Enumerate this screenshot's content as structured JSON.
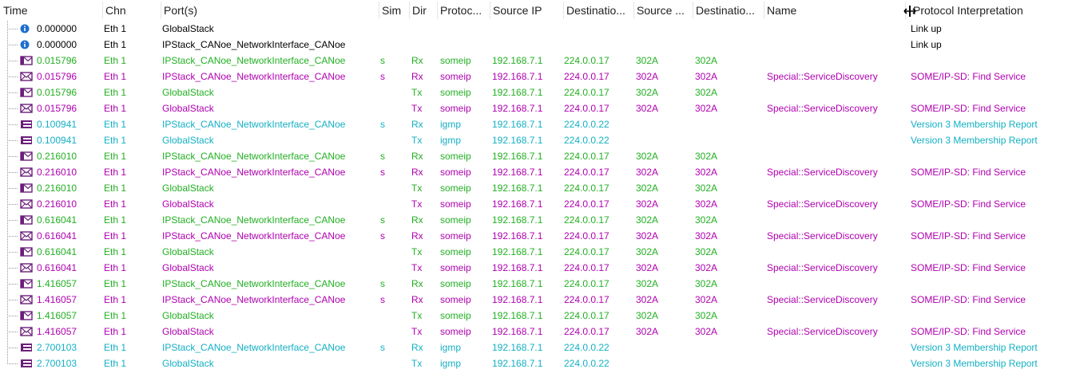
{
  "header": {
    "columns": [
      {
        "key": "time",
        "label": "Time"
      },
      {
        "key": "chn",
        "label": "Chn"
      },
      {
        "key": "ports",
        "label": "Port(s)"
      },
      {
        "key": "sim",
        "label": "Sim"
      },
      {
        "key": "dir",
        "label": "Dir"
      },
      {
        "key": "proto",
        "label": "Protoc..."
      },
      {
        "key": "src_ip",
        "label": "Source IP"
      },
      {
        "key": "dst",
        "label": "Destinatio..."
      },
      {
        "key": "src_port",
        "label": "Source ..."
      },
      {
        "key": "dst_port",
        "label": "Destinatio..."
      },
      {
        "key": "name",
        "label": "Name"
      },
      {
        "key": "interp",
        "label": "Protocol Interpretation"
      }
    ]
  },
  "colors": {
    "black": "#000000",
    "green": "#22b022",
    "magenta": "#b000b0",
    "cyan": "#14b0c4",
    "icon_blue": "#1e6fd0",
    "tree": "#9a9a9a"
  },
  "rows": [
    {
      "icon": "info-icon",
      "color": "black",
      "time": "0.000000",
      "chn": "Eth 1",
      "ports": "GlobalStack",
      "sim": "",
      "dir": "",
      "proto": "",
      "src_ip": "",
      "dst": "",
      "src_port": "",
      "dst_port": "",
      "name": "",
      "interp": "Link up"
    },
    {
      "icon": "info-icon",
      "color": "black",
      "time": "0.000000",
      "chn": "Eth 1",
      "ports": "IPStack_CANoe_NetworkInterface_CANoe",
      "sim": "",
      "dir": "",
      "proto": "",
      "src_ip": "",
      "dst": "",
      "src_port": "",
      "dst_port": "",
      "name": "",
      "interp": "Link up"
    },
    {
      "icon": "frame-icon",
      "color": "green",
      "time": "0.015796",
      "chn": "Eth 1",
      "ports": "IPStack_CANoe_NetworkInterface_CANoe",
      "sim": "s",
      "dir": "Rx",
      "proto": "someip",
      "src_ip": "192.168.7.1",
      "dst": "224.0.0.17",
      "src_port": "302A",
      "dst_port": "302A",
      "name": "",
      "interp": ""
    },
    {
      "icon": "message-icon",
      "color": "magenta",
      "time": "0.015796",
      "chn": "Eth 1",
      "ports": "IPStack_CANoe_NetworkInterface_CANoe",
      "sim": "s",
      "dir": "Rx",
      "proto": "someip",
      "src_ip": "192.168.7.1",
      "dst": "224.0.0.17",
      "src_port": "302A",
      "dst_port": "302A",
      "name": "Special::ServiceDiscovery",
      "interp": "SOME/IP-SD: Find Service"
    },
    {
      "icon": "frame-icon",
      "color": "green",
      "time": "0.015796",
      "chn": "Eth 1",
      "ports": "GlobalStack",
      "sim": "",
      "dir": "Tx",
      "proto": "someip",
      "src_ip": "192.168.7.1",
      "dst": "224.0.0.17",
      "src_port": "302A",
      "dst_port": "302A",
      "name": "",
      "interp": ""
    },
    {
      "icon": "message-icon",
      "color": "magenta",
      "time": "0.015796",
      "chn": "Eth 1",
      "ports": "GlobalStack",
      "sim": "",
      "dir": "Tx",
      "proto": "someip",
      "src_ip": "192.168.7.1",
      "dst": "224.0.0.17",
      "src_port": "302A",
      "dst_port": "302A",
      "name": "Special::ServiceDiscovery",
      "interp": "SOME/IP-SD: Find Service"
    },
    {
      "icon": "packet-icon",
      "color": "cyan",
      "time": "0.100941",
      "chn": "Eth 1",
      "ports": "IPStack_CANoe_NetworkInterface_CANoe",
      "sim": "s",
      "dir": "Rx",
      "proto": "igmp",
      "src_ip": "192.168.7.1",
      "dst": "224.0.0.22",
      "src_port": "",
      "dst_port": "",
      "name": "",
      "interp": "Version 3 Membership Report"
    },
    {
      "icon": "packet-icon",
      "color": "cyan",
      "time": "0.100941",
      "chn": "Eth 1",
      "ports": "GlobalStack",
      "sim": "",
      "dir": "Tx",
      "proto": "igmp",
      "src_ip": "192.168.7.1",
      "dst": "224.0.0.22",
      "src_port": "",
      "dst_port": "",
      "name": "",
      "interp": "Version 3 Membership Report"
    },
    {
      "icon": "frame-icon",
      "color": "green",
      "time": "0.216010",
      "chn": "Eth 1",
      "ports": "IPStack_CANoe_NetworkInterface_CANoe",
      "sim": "s",
      "dir": "Rx",
      "proto": "someip",
      "src_ip": "192.168.7.1",
      "dst": "224.0.0.17",
      "src_port": "302A",
      "dst_port": "302A",
      "name": "",
      "interp": ""
    },
    {
      "icon": "message-icon",
      "color": "magenta",
      "time": "0.216010",
      "chn": "Eth 1",
      "ports": "IPStack_CANoe_NetworkInterface_CANoe",
      "sim": "s",
      "dir": "Rx",
      "proto": "someip",
      "src_ip": "192.168.7.1",
      "dst": "224.0.0.17",
      "src_port": "302A",
      "dst_port": "302A",
      "name": "Special::ServiceDiscovery",
      "interp": "SOME/IP-SD: Find Service"
    },
    {
      "icon": "frame-icon",
      "color": "green",
      "time": "0.216010",
      "chn": "Eth 1",
      "ports": "GlobalStack",
      "sim": "",
      "dir": "Tx",
      "proto": "someip",
      "src_ip": "192.168.7.1",
      "dst": "224.0.0.17",
      "src_port": "302A",
      "dst_port": "302A",
      "name": "",
      "interp": ""
    },
    {
      "icon": "message-icon",
      "color": "magenta",
      "time": "0.216010",
      "chn": "Eth 1",
      "ports": "GlobalStack",
      "sim": "",
      "dir": "Tx",
      "proto": "someip",
      "src_ip": "192.168.7.1",
      "dst": "224.0.0.17",
      "src_port": "302A",
      "dst_port": "302A",
      "name": "Special::ServiceDiscovery",
      "interp": "SOME/IP-SD: Find Service"
    },
    {
      "icon": "frame-icon",
      "color": "green",
      "time": "0.616041",
      "chn": "Eth 1",
      "ports": "IPStack_CANoe_NetworkInterface_CANoe",
      "sim": "s",
      "dir": "Rx",
      "proto": "someip",
      "src_ip": "192.168.7.1",
      "dst": "224.0.0.17",
      "src_port": "302A",
      "dst_port": "302A",
      "name": "",
      "interp": ""
    },
    {
      "icon": "message-icon",
      "color": "magenta",
      "time": "0.616041",
      "chn": "Eth 1",
      "ports": "IPStack_CANoe_NetworkInterface_CANoe",
      "sim": "s",
      "dir": "Rx",
      "proto": "someip",
      "src_ip": "192.168.7.1",
      "dst": "224.0.0.17",
      "src_port": "302A",
      "dst_port": "302A",
      "name": "Special::ServiceDiscovery",
      "interp": "SOME/IP-SD: Find Service"
    },
    {
      "icon": "frame-icon",
      "color": "green",
      "time": "0.616041",
      "chn": "Eth 1",
      "ports": "GlobalStack",
      "sim": "",
      "dir": "Tx",
      "proto": "someip",
      "src_ip": "192.168.7.1",
      "dst": "224.0.0.17",
      "src_port": "302A",
      "dst_port": "302A",
      "name": "",
      "interp": ""
    },
    {
      "icon": "message-icon",
      "color": "magenta",
      "time": "0.616041",
      "chn": "Eth 1",
      "ports": "GlobalStack",
      "sim": "",
      "dir": "Tx",
      "proto": "someip",
      "src_ip": "192.168.7.1",
      "dst": "224.0.0.17",
      "src_port": "302A",
      "dst_port": "302A",
      "name": "Special::ServiceDiscovery",
      "interp": "SOME/IP-SD: Find Service"
    },
    {
      "icon": "frame-icon",
      "color": "green",
      "time": "1.416057",
      "chn": "Eth 1",
      "ports": "IPStack_CANoe_NetworkInterface_CANoe",
      "sim": "s",
      "dir": "Rx",
      "proto": "someip",
      "src_ip": "192.168.7.1",
      "dst": "224.0.0.17",
      "src_port": "302A",
      "dst_port": "302A",
      "name": "",
      "interp": ""
    },
    {
      "icon": "message-icon",
      "color": "magenta",
      "time": "1.416057",
      "chn": "Eth 1",
      "ports": "IPStack_CANoe_NetworkInterface_CANoe",
      "sim": "s",
      "dir": "Rx",
      "proto": "someip",
      "src_ip": "192.168.7.1",
      "dst": "224.0.0.17",
      "src_port": "302A",
      "dst_port": "302A",
      "name": "Special::ServiceDiscovery",
      "interp": "SOME/IP-SD: Find Service"
    },
    {
      "icon": "frame-icon",
      "color": "green",
      "time": "1.416057",
      "chn": "Eth 1",
      "ports": "GlobalStack",
      "sim": "",
      "dir": "Tx",
      "proto": "someip",
      "src_ip": "192.168.7.1",
      "dst": "224.0.0.17",
      "src_port": "302A",
      "dst_port": "302A",
      "name": "",
      "interp": ""
    },
    {
      "icon": "message-icon",
      "color": "magenta",
      "time": "1.416057",
      "chn": "Eth 1",
      "ports": "GlobalStack",
      "sim": "",
      "dir": "Tx",
      "proto": "someip",
      "src_ip": "192.168.7.1",
      "dst": "224.0.0.17",
      "src_port": "302A",
      "dst_port": "302A",
      "name": "Special::ServiceDiscovery",
      "interp": "SOME/IP-SD: Find Service"
    },
    {
      "icon": "packet-icon",
      "color": "cyan",
      "time": "2.700103",
      "chn": "Eth 1",
      "ports": "IPStack_CANoe_NetworkInterface_CANoe",
      "sim": "s",
      "dir": "Rx",
      "proto": "igmp",
      "src_ip": "192.168.7.1",
      "dst": "224.0.0.22",
      "src_port": "",
      "dst_port": "",
      "name": "",
      "interp": "Version 3 Membership Report"
    },
    {
      "icon": "packet-icon",
      "color": "cyan",
      "time": "2.700103",
      "chn": "Eth 1",
      "ports": "GlobalStack",
      "sim": "",
      "dir": "Tx",
      "proto": "igmp",
      "src_ip": "192.168.7.1",
      "dst": "224.0.0.22",
      "src_port": "",
      "dst_port": "",
      "name": "",
      "interp": "Version 3 Membership Report"
    }
  ]
}
